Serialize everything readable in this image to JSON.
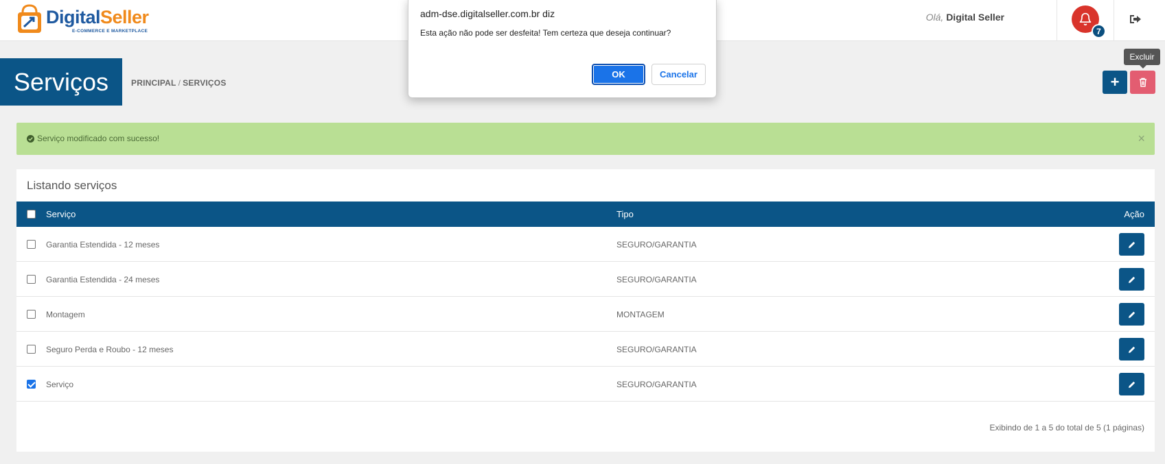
{
  "header": {
    "logo_brand_a": "Digital",
    "logo_brand_b": "Seller",
    "logo_tagline": "E-COMMERCE E MARKETPLACE",
    "greeting_prefix": "Olá,",
    "user_name": "Digital Seller",
    "notification_count": "7",
    "icons": {
      "bell": "bell-icon",
      "logout": "logout-icon"
    }
  },
  "page": {
    "title": "Serviços",
    "breadcrumb": {
      "home": "PRINCIPAL",
      "separator": "/",
      "current": "SERVIÇOS"
    },
    "add_label": "+",
    "delete_tooltip": "Excluir"
  },
  "alert": {
    "message": "Serviço modificado com sucesso!",
    "close": "×"
  },
  "panel": {
    "title": "Listando serviços",
    "columns": {
      "service": "Serviço",
      "type": "Tipo",
      "action": "Ação"
    },
    "rows": [
      {
        "service": "Garantia Estendida - 12 meses",
        "type": "SEGURO/GARANTIA",
        "checked": false
      },
      {
        "service": "Garantia Estendida - 24 meses",
        "type": "SEGURO/GARANTIA",
        "checked": false
      },
      {
        "service": "Montagem",
        "type": "MONTAGEM",
        "checked": false
      },
      {
        "service": "Seguro Perda e Roubo - 12 meses",
        "type": "SEGURO/GARANTIA",
        "checked": false
      },
      {
        "service": "Serviço",
        "type": "SEGURO/GARANTIA",
        "checked": true
      }
    ],
    "paging": "Exibindo de 1 a 5 do total de 5 (1 páginas)"
  },
  "dialog": {
    "title": "adm-dse.digitalseller.com.br diz",
    "message": "Esta ação não pode ser desfeita! Tem certeza que deseja continuar?",
    "ok": "OK",
    "cancel": "Cancelar"
  },
  "colors": {
    "primary": "#0b5587",
    "danger": "#e35d71",
    "success_bg": "#b9df94",
    "bell": "#d9342b",
    "dialog_button": "#1a73e8"
  }
}
